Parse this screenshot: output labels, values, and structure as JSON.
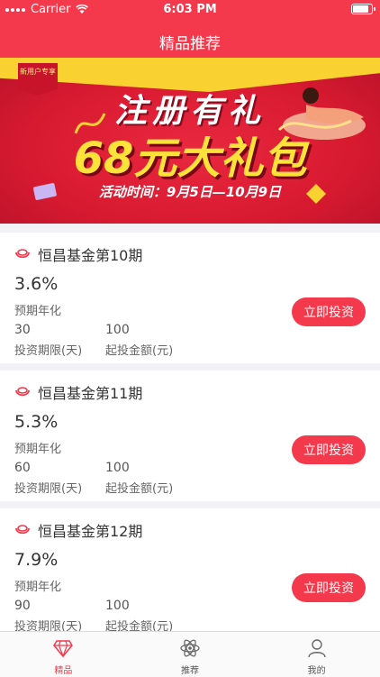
{
  "status_bar": {
    "carrier": "Carrier",
    "time": "6:03 PM"
  },
  "nav": {
    "title": "精品推荐"
  },
  "banner": {
    "badge": "新用户专享",
    "line1": "注册有礼",
    "line2": "68元大礼包",
    "line3": "活动时间：9月5日—10月9日"
  },
  "products": [
    {
      "name": "恒昌基金第10期",
      "rate": "3.6%",
      "rate_label": "预期年化",
      "term": "30",
      "term_label": "投资期限(天)",
      "min_amount": "100",
      "min_label": "起投金额(元)",
      "button": "立即投资"
    },
    {
      "name": "恒昌基金第11期",
      "rate": "5.3%",
      "rate_label": "预期年化",
      "term": "60",
      "term_label": "投资期限(天)",
      "min_amount": "100",
      "min_label": "起投金额(元)",
      "button": "立即投资"
    },
    {
      "name": "恒昌基金第12期",
      "rate": "7.9%",
      "rate_label": "预期年化",
      "term": "90",
      "term_label": "投资期限(天)",
      "min_amount": "100",
      "min_label": "起投金额(元)",
      "button": "立即投资"
    }
  ],
  "tabs": [
    {
      "label": "精品",
      "icon": "diamond-icon",
      "active": true
    },
    {
      "label": "推荐",
      "icon": "atom-icon",
      "active": false
    },
    {
      "label": "我的",
      "icon": "user-icon",
      "active": false
    }
  ],
  "colors": {
    "accent": "#f3394b",
    "banner_yellow": "#fde23a"
  }
}
